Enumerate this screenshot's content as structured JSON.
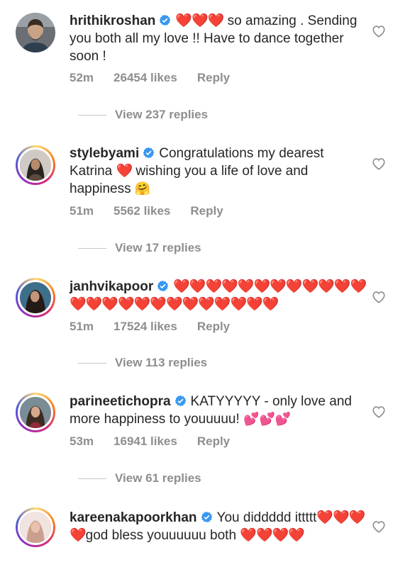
{
  "comments": [
    {
      "username": "hrithikroshan",
      "text_parts": [
        "❤️❤️❤️",
        " so amazing . Sending you both all my love !! Have to dance together soon !"
      ],
      "time": "52m",
      "likes": "26454 likes",
      "reply": "Reply",
      "view_replies": "View 237 replies"
    },
    {
      "username": "stylebyami",
      "text_parts": [
        "Congratulations my dearest Katrina ",
        "❤️",
        " wishing you a life of love and happiness ",
        "🤗"
      ],
      "time": "51m",
      "likes": "5562 likes",
      "reply": "Reply",
      "view_replies": "View 17 replies"
    },
    {
      "username": "janhvikapoor",
      "text_parts": [
        "❤️❤️❤️❤️❤️❤️❤️❤️❤️❤️❤️❤️❤️❤️❤️❤️❤️❤️❤️❤️❤️❤️❤️❤️❤️"
      ],
      "time": "51m",
      "likes": "17524 likes",
      "reply": "Reply",
      "view_replies": "View 113 replies"
    },
    {
      "username": "parineetichopra",
      "text_parts": [
        "KATYYYYY - only love and more happiness to youuuuu! ",
        "💕💕💕"
      ],
      "time": "53m",
      "likes": "16941 likes",
      "reply": "Reply",
      "view_replies": "View 61 replies"
    },
    {
      "username": "kareenakapoorkhan",
      "text_parts": [
        "You diddddd ittttt",
        "❤️❤️❤️❤️",
        "god bless youuuuuu both ",
        "❤️❤️❤️❤️"
      ]
    }
  ],
  "colors": {
    "primary_text": "#262626",
    "secondary_text": "#8e8e8e",
    "verified": "#3897f0",
    "heart": "#e0141e"
  },
  "icons": {
    "verified": "verified-badge-icon",
    "like": "heart-outline-icon"
  }
}
